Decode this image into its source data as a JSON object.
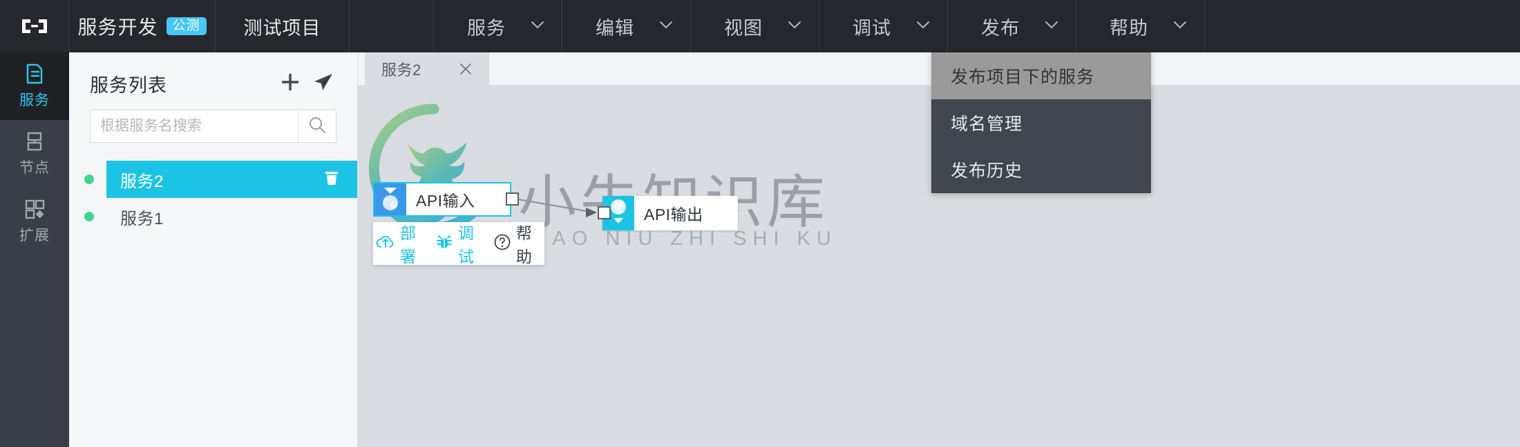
{
  "topbar": {
    "logo_icon": "brackets-logo-icon",
    "app_title": "服务开发",
    "beta_badge": "公测",
    "project_title": "测试项目",
    "menus": [
      {
        "label": "服务",
        "icon": "chevron-down-icon"
      },
      {
        "label": "编辑",
        "icon": "chevron-down-icon"
      },
      {
        "label": "视图",
        "icon": "chevron-down-icon"
      },
      {
        "label": "调试",
        "icon": "chevron-down-icon"
      },
      {
        "label": "发布",
        "icon": "chevron-down-icon"
      },
      {
        "label": "帮助",
        "icon": "chevron-down-icon"
      }
    ]
  },
  "dropdown": {
    "owner": "发布",
    "items": [
      {
        "label": "发布项目下的服务",
        "hovered": true
      },
      {
        "label": "域名管理",
        "hovered": false
      },
      {
        "label": "发布历史",
        "hovered": false
      }
    ]
  },
  "rail": {
    "items": [
      {
        "label": "服务",
        "icon": "document-icon",
        "active": true
      },
      {
        "label": "节点",
        "icon": "node-grid-icon",
        "active": false
      },
      {
        "label": "扩展",
        "icon": "extension-blocks-icon",
        "active": false
      }
    ]
  },
  "panel": {
    "title": "服务列表",
    "add_icon": "plus-icon",
    "send_icon": "paper-plane-icon",
    "search": {
      "value": "",
      "placeholder": "根据服务名搜索",
      "icon": "search-icon"
    },
    "services": [
      {
        "name": "服务2",
        "selected": true,
        "status_color": "#3fd48c",
        "delete_icon": "trash-icon"
      },
      {
        "name": "服务1",
        "selected": false,
        "status_color": "#3fd48c",
        "delete_icon": ""
      }
    ]
  },
  "tabs": [
    {
      "label": "服务2",
      "active": true,
      "close_icon": "close-icon"
    }
  ],
  "canvas": {
    "watermark": {
      "title": "小牛知识库",
      "subtitle": "XIAO NIU ZHI SHI KU",
      "logo_icon": "ox-circle-logo-icon"
    },
    "nodes": [
      {
        "id": "api-input",
        "label": "API输入",
        "badge_color": "#3b97ea",
        "selected": true,
        "badge_icon": "chevron-down-circle-icon"
      },
      {
        "id": "api-output",
        "label": "API输出",
        "badge_color": "#1dc3e4",
        "selected": false,
        "badge_icon": "circle-chevron-down-icon"
      }
    ],
    "ports": [
      {
        "name": "output-port",
        "node": "api-input"
      },
      {
        "name": "input-port",
        "node": "api-output"
      }
    ],
    "edge": {
      "from": "api-input",
      "to": "api-output",
      "arrow": true
    },
    "actionbar": [
      {
        "label": "部署",
        "icon": "cloud-upload-icon",
        "tone": "cyan"
      },
      {
        "label": "调试",
        "icon": "bug-icon",
        "tone": "cyan"
      },
      {
        "label": "帮助",
        "icon": "question-circle-icon",
        "tone": "dark"
      }
    ]
  },
  "colors": {
    "topbar_bg": "#26272c",
    "rail_bg": "#3a3f47",
    "accent_cyan": "#1dc3e4",
    "accent_blue": "#3b97ea",
    "status_green": "#3fd48c",
    "canvas_bg": "#d9dce0",
    "dropdown_bg": "#3f464e",
    "dropdown_hover": "#9a9a9a"
  }
}
